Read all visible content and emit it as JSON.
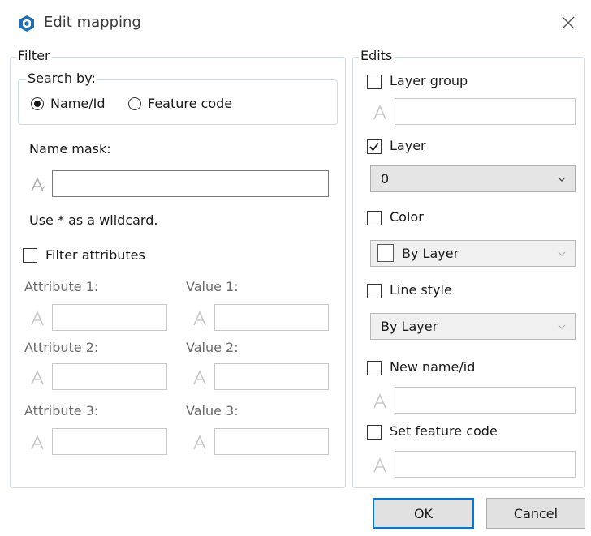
{
  "window": {
    "title": "Edit mapping"
  },
  "filter": {
    "legend": "Filter",
    "search_by": {
      "legend": "Search by:",
      "options": [
        {
          "label": "Name/Id",
          "checked": true
        },
        {
          "label": "Feature code",
          "checked": false
        }
      ]
    },
    "name_mask_label": "Name mask:",
    "name_mask_value": "",
    "wildcard_hint": "Use * as a wildcard.",
    "filter_attributes": {
      "label": "Filter attributes",
      "checked": false
    },
    "attributes": [
      {
        "attr_label": "Attribute 1:",
        "value_label": "Value 1:"
      },
      {
        "attr_label": "Attribute 2:",
        "value_label": "Value 2:"
      },
      {
        "attr_label": "Attribute 3:",
        "value_label": "Value 3:"
      }
    ]
  },
  "edits": {
    "legend": "Edits",
    "layer_group": {
      "label": "Layer group",
      "checked": false
    },
    "layer": {
      "label": "Layer",
      "checked": true,
      "selected": "0"
    },
    "color": {
      "label": "Color",
      "checked": false,
      "selected": "By Layer"
    },
    "line_style": {
      "label": "Line style",
      "checked": false,
      "selected": "By Layer"
    },
    "new_name": {
      "label": "New name/id",
      "checked": false
    },
    "feature_code": {
      "label": "Set feature code",
      "checked": false
    }
  },
  "buttons": {
    "ok": "OK",
    "cancel": "Cancel"
  },
  "colors": {
    "accent": "#0078d7",
    "icon_blue": "#1e6fb5",
    "group_border": "#cfdbe6"
  },
  "icons": {
    "app": "cube-icon",
    "close": "close-icon",
    "field": "text-field-icon",
    "dropdown": "chevron-down-icon"
  }
}
